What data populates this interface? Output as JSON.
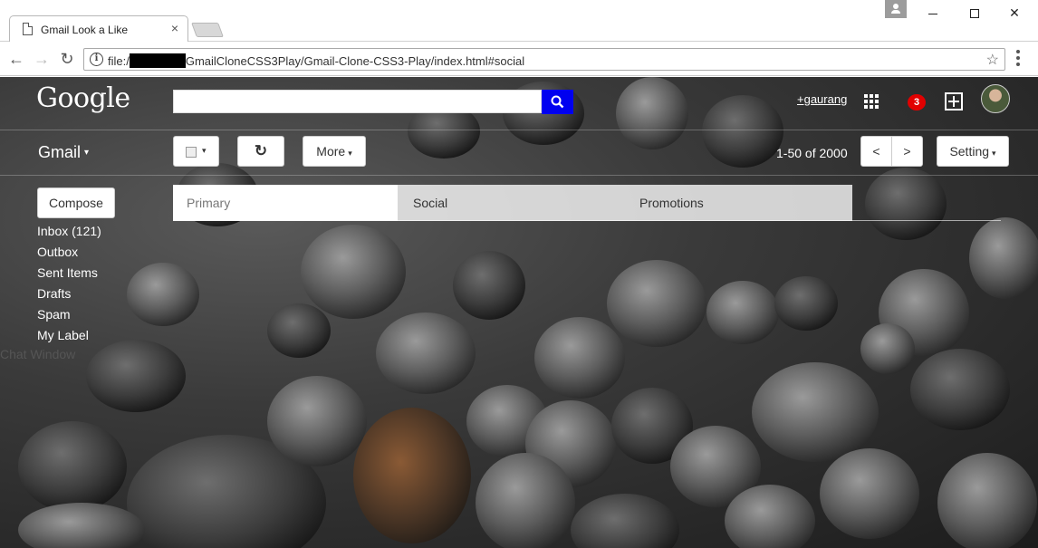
{
  "browser": {
    "tab_title": "Gmail Look a Like",
    "tab_close": "×",
    "url_prefix": "file:/",
    "url_suffix": "GmailCloneCSS3Play/Gmail-Clone-CSS3-Play/index.html#social",
    "info_glyph": "i",
    "star_glyph": "☆",
    "back_glyph": "←",
    "forward_glyph": "→",
    "reload_glyph": "↻",
    "close_glyph": "✕"
  },
  "header": {
    "logo_text": "Google",
    "user_name": "+gaurang",
    "notification_count": "3"
  },
  "toolbar": {
    "app_label": "Gmail",
    "caret": "▾",
    "refresh_glyph": "↻",
    "more_label": "More",
    "pager_text": "1-50 of 2000",
    "prev_label": "<",
    "next_label": ">",
    "setting_label": "Setting"
  },
  "sidebar": {
    "compose_label": "Compose",
    "items": [
      {
        "label": "Inbox (121)"
      },
      {
        "label": "Outbox"
      },
      {
        "label": "Sent Items"
      },
      {
        "label": "Drafts"
      },
      {
        "label": "Spam"
      },
      {
        "label": "My Label"
      }
    ],
    "chat_window": "Chat Window"
  },
  "tabs": {
    "items": [
      {
        "label": "Primary"
      },
      {
        "label": "Social"
      },
      {
        "label": "Promotions"
      }
    ],
    "active": "Social"
  },
  "colors": {
    "search_button": "#0000f0",
    "badge": "#e20000"
  }
}
